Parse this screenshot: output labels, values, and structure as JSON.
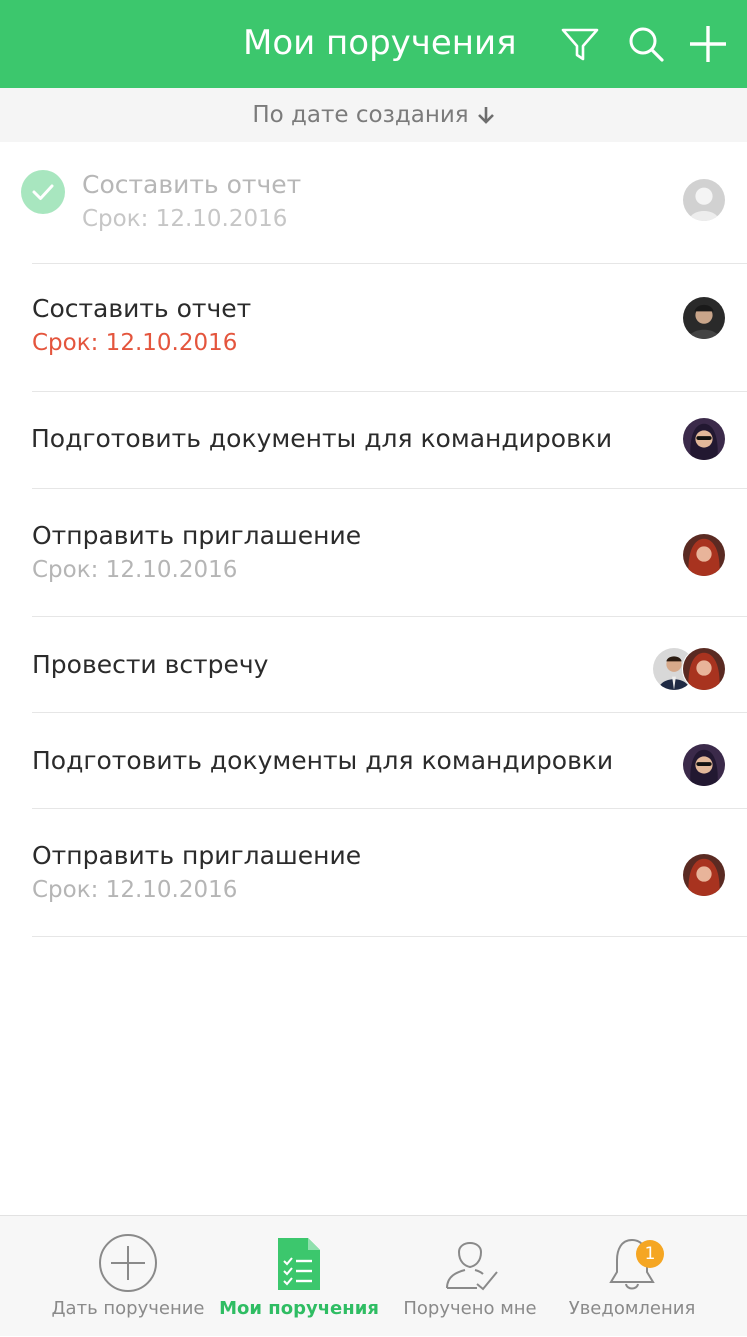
{
  "header": {
    "title": "Мои поручения",
    "background": "#3cc76d",
    "actions": [
      "filter-icon",
      "search-icon",
      "plus-icon"
    ]
  },
  "sort": {
    "label": "По дате создания",
    "direction_icon": "arrow-down-icon"
  },
  "tasks": [
    {
      "title": "Составить отчет",
      "due": "Срок: 12.10.2016",
      "completed": true,
      "overdue": false,
      "assignees": [
        "person"
      ]
    },
    {
      "title": "Составить отчет",
      "due": "Срок: 12.10.2016",
      "completed": false,
      "overdue": true,
      "assignees": [
        "person"
      ]
    },
    {
      "title": "Подготовить документы для командировки",
      "due": "",
      "completed": false,
      "overdue": false,
      "assignees": [
        "person"
      ]
    },
    {
      "title": "Отправить приглашение",
      "due": "Срок: 12.10.2016",
      "completed": false,
      "overdue": false,
      "assignees": [
        "person"
      ]
    },
    {
      "title": "Провести встречу",
      "due": "",
      "completed": false,
      "overdue": false,
      "assignees": [
        "person",
        "person"
      ]
    },
    {
      "title": "Подготовить документы для командировки",
      "due": "",
      "completed": false,
      "overdue": false,
      "assignees": [
        "person"
      ]
    },
    {
      "title": "Отправить приглашение",
      "due": "Срок: 12.10.2016",
      "completed": false,
      "overdue": false,
      "assignees": [
        "person"
      ]
    }
  ],
  "tabbar": {
    "tabs": [
      {
        "label": "Дать поручение",
        "icon": "plus-circle-icon",
        "active": false
      },
      {
        "label": "Мои поручения",
        "icon": "checklist-icon",
        "active": true
      },
      {
        "label": "Поручено мне",
        "icon": "person-check-icon",
        "active": false
      },
      {
        "label": "Уведомления",
        "icon": "bell-icon",
        "active": false,
        "badge": "1"
      }
    ]
  },
  "colors": {
    "accent": "#3cc76d",
    "overdue": "#e4553d",
    "badge": "#f5a623"
  }
}
